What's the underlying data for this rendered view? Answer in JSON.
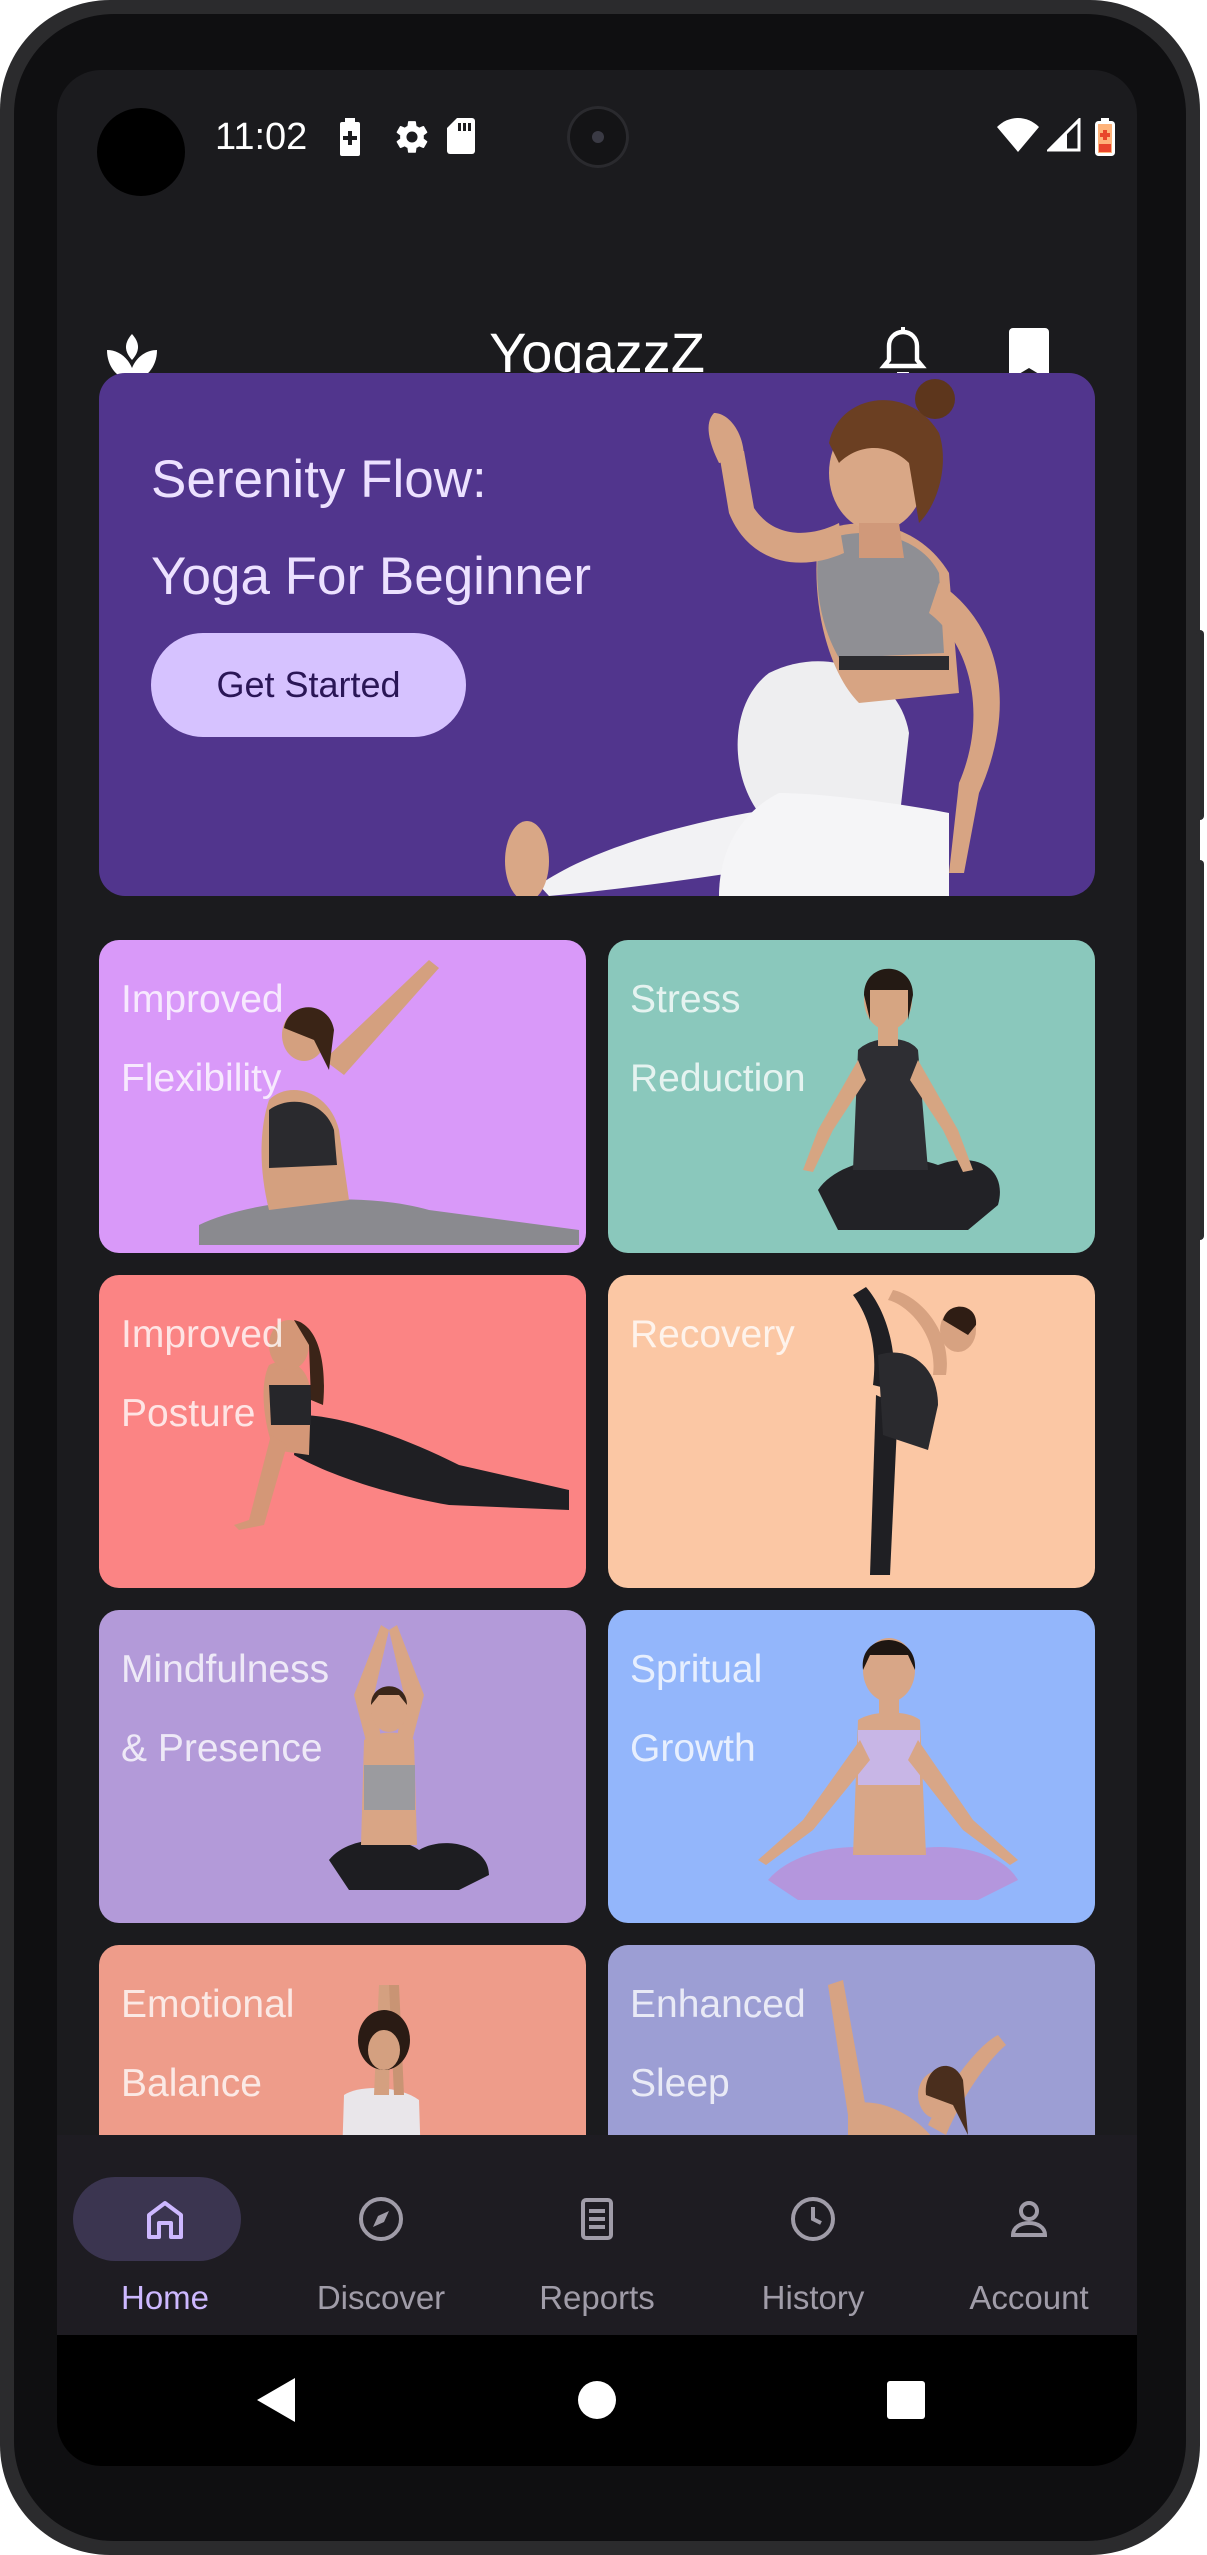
{
  "status_bar": {
    "time": "11:02",
    "icons": [
      "battery-saver-icon",
      "settings-gear-icon",
      "sd-card-icon",
      "wifi-icon",
      "signal-icon",
      "battery-low-icon"
    ]
  },
  "app_bar": {
    "title": "YogazzZ",
    "left_icon": "lotus-logo-icon",
    "right_icons": [
      "notification-bell-icon",
      "bookmark-icon"
    ]
  },
  "hero": {
    "title_line1": "Serenity Flow:",
    "title_line2": "Yoga For Beginner",
    "button_label": "Get Started",
    "background": "#51358d"
  },
  "tiles": [
    {
      "line1": "Improved",
      "line2": "Flexibility",
      "color": "#d999f9"
    },
    {
      "line1": "Stress",
      "line2": "Reduction",
      "color": "#8ac8bc"
    },
    {
      "line1": "Improved",
      "line2": "Posture",
      "color": "#fb8484"
    },
    {
      "line1": "Recovery",
      "line2": "",
      "color": "#fbc7a4"
    },
    {
      "line1": "Mindfulness",
      "line2": "& Presence",
      "color": "#b39ad9"
    },
    {
      "line1": "Spritual",
      "line2": "Growth",
      "color": "#93b6fb"
    },
    {
      "line1": "Emotional",
      "line2": "Balance",
      "color": "#ee9c8a"
    },
    {
      "line1": "Enhanced",
      "line2": "Sleep",
      "color": "#9c9ed4"
    }
  ],
  "bottom_nav": [
    {
      "label": "Home",
      "icon": "home-icon",
      "active": true
    },
    {
      "label": "Discover",
      "icon": "compass-icon",
      "active": false
    },
    {
      "label": "Reports",
      "icon": "report-document-icon",
      "active": false
    },
    {
      "label": "History",
      "icon": "clock-icon",
      "active": false
    },
    {
      "label": "Account",
      "icon": "person-icon",
      "active": false
    }
  ],
  "system_nav": [
    "back-icon",
    "home-circle-icon",
    "recents-square-icon"
  ]
}
